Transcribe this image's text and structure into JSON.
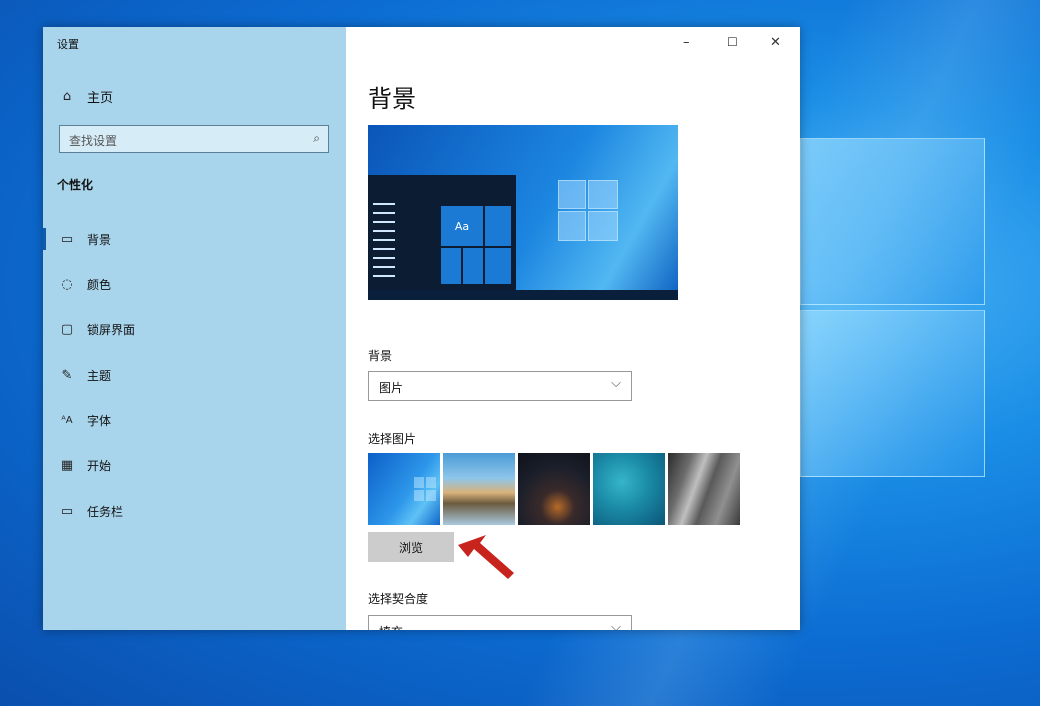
{
  "window": {
    "title": "设置"
  },
  "controls": {
    "minimize": "–",
    "maximize": "☐",
    "close": "✕"
  },
  "sidebar": {
    "home": {
      "icon": "home-icon",
      "label": "主页"
    },
    "search": {
      "placeholder": "查找设置"
    },
    "section": "个性化",
    "items": [
      {
        "icon": "picture-icon",
        "label": "背景",
        "selected": true
      },
      {
        "icon": "palette-icon",
        "label": "颜色"
      },
      {
        "icon": "lockscreen-icon",
        "label": "锁屏界面"
      },
      {
        "icon": "theme-icon",
        "label": "主题"
      },
      {
        "icon": "font-icon",
        "label": "字体"
      },
      {
        "icon": "start-icon",
        "label": "开始"
      },
      {
        "icon": "taskbar-icon",
        "label": "任务栏"
      }
    ]
  },
  "main": {
    "title": "背景",
    "preview_tile_text": "Aa",
    "background_label": "背景",
    "background_value": "图片",
    "choose_picture_label": "选择图片",
    "browse_label": "浏览",
    "fit_label": "选择契合度",
    "fit_value": "填充"
  },
  "colors": {
    "sidebar": "#a9d5ec",
    "accent": "#0f5ca8",
    "arrow": "#c8241e"
  }
}
